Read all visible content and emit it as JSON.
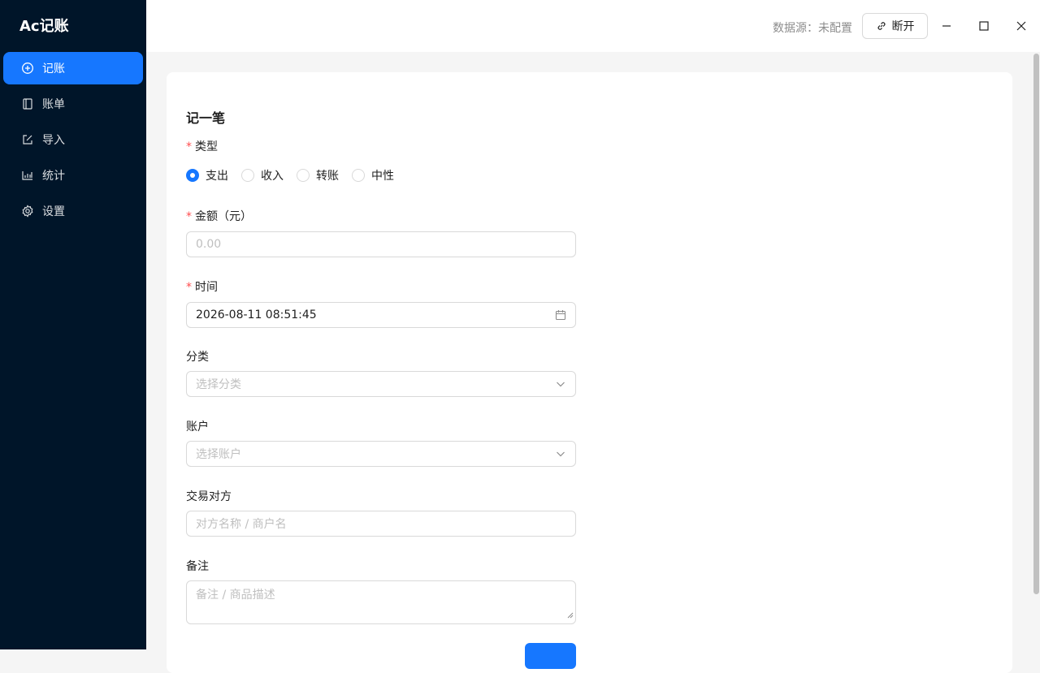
{
  "sidebar": {
    "logo": "Ac记账",
    "items": [
      {
        "label": "记账",
        "icon": "plus-circle-icon",
        "active": true
      },
      {
        "label": "账单",
        "icon": "book-icon"
      },
      {
        "label": "导入",
        "icon": "edit-square-icon"
      },
      {
        "label": "统计",
        "icon": "bar-chart-icon"
      },
      {
        "label": "设置",
        "icon": "gear-icon"
      }
    ]
  },
  "header": {
    "datasource_label": "数据源：未配置",
    "disconnect_label": "断开"
  },
  "form": {
    "title": "记一笔",
    "type": {
      "required": "*",
      "label": "类型",
      "options": [
        "支出",
        "收入",
        "转账",
        "中性"
      ],
      "selected": "支出"
    },
    "amount": {
      "required": "*",
      "label": "金额（元）",
      "placeholder": "0.00"
    },
    "time": {
      "required": "*",
      "label": "时间",
      "value": "2026-08-11 08:51:45"
    },
    "category": {
      "label": "分类",
      "placeholder": "选择分类"
    },
    "account": {
      "label": "账户",
      "placeholder": "选择账户"
    },
    "counterparty": {
      "label": "交易对方",
      "placeholder": "对方名称 / 商户名"
    },
    "note": {
      "label": "备注",
      "placeholder": "备注 / 商品描述"
    }
  },
  "colors": {
    "sidebar_bg": "#001529",
    "accent": "#1677ff",
    "required": "#ff4d4f"
  }
}
